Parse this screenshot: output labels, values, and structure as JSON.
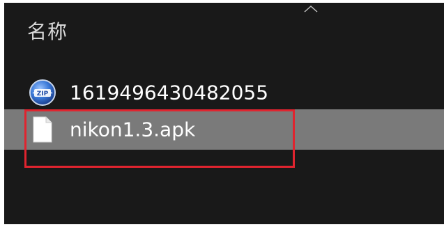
{
  "file_list": {
    "column_header": "名称",
    "sort_icon": "chevron-up-icon",
    "items": [
      {
        "name": "1619496430482055",
        "icon": "zip-archive-icon",
        "selected": false
      },
      {
        "name": "nikon1.3.apk",
        "icon": "generic-file-icon",
        "selected": true
      }
    ]
  },
  "annotation": {
    "highlight_color": "#e0242f"
  }
}
